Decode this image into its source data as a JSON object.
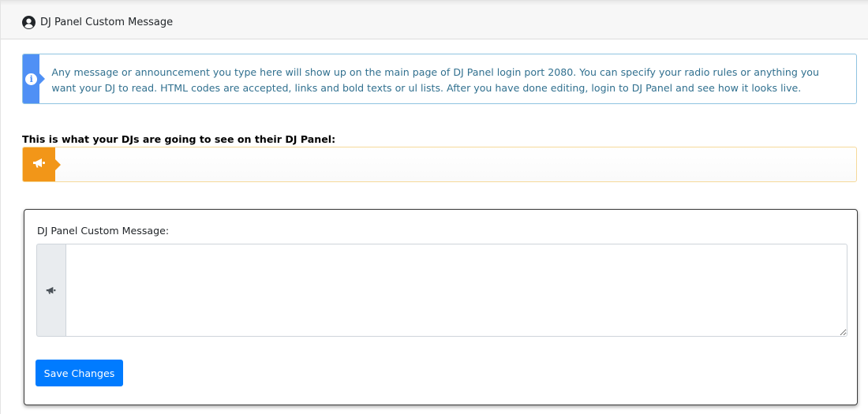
{
  "header": {
    "title": "DJ Panel Custom Message",
    "icon": "user-circle-icon"
  },
  "info": {
    "icon": "info-circle-icon",
    "text": "Any message or announcement you type here will show up on the main page of DJ Panel login port 2080. You can specify your radio rules or anything you want your DJ to read. HTML codes are accepted, links and bold texts or ul lists. After you have done editing, login to DJ Panel and see how it looks live."
  },
  "preview": {
    "label": "This is what your DJs are going to see on their DJ Panel:",
    "icon": "bullhorn-icon",
    "message": ""
  },
  "form": {
    "label": "DJ Panel Custom Message:",
    "addon_icon": "bullhorn-icon",
    "textarea_value": "",
    "save_label": "Save Changes"
  },
  "colors": {
    "info_accent": "#4f90f5",
    "warning_accent": "#f29618",
    "primary_button": "#007bff"
  }
}
